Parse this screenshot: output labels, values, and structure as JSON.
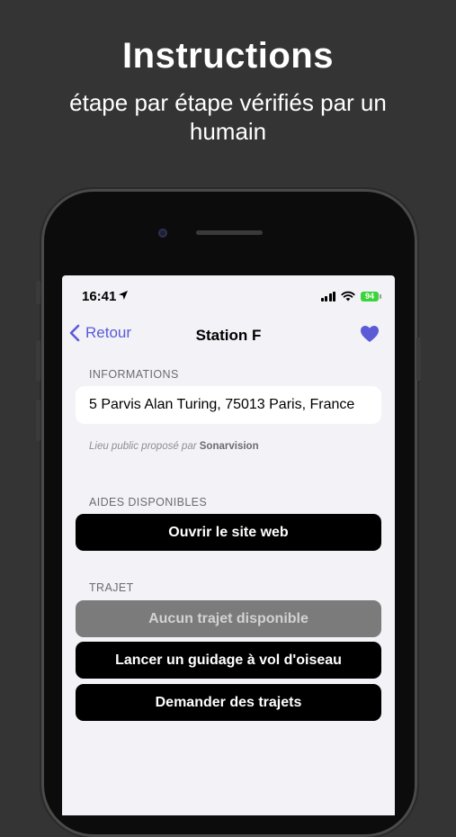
{
  "promo": {
    "title": "Instructions",
    "subtitle": "étape par étape vérifiés par un humain"
  },
  "status_bar": {
    "time": "16:41",
    "battery": "94"
  },
  "nav": {
    "back_label": "Retour",
    "title": "Station F",
    "favorite_icon": "heart-icon"
  },
  "informations": {
    "header": "INFORMATIONS",
    "address": "5 Parvis Alan Turing, 75013 Paris, France",
    "footnote_prefix": "Lieu public proposé par",
    "footnote_author": "Sonarvision"
  },
  "aides": {
    "header": "AIDES DISPONIBLES",
    "open_website": "Ouvrir le site web"
  },
  "trajet": {
    "header": "TRAJET",
    "no_route": "Aucun trajet disponible",
    "bird_guidance": "Lancer un guidage à vol d'oiseau",
    "request_routes": "Demander des trajets"
  },
  "colors": {
    "accent": "#5b5bd6",
    "background": "#343434",
    "screen_background": "#f2f2f7",
    "battery": "#3bd43b"
  }
}
